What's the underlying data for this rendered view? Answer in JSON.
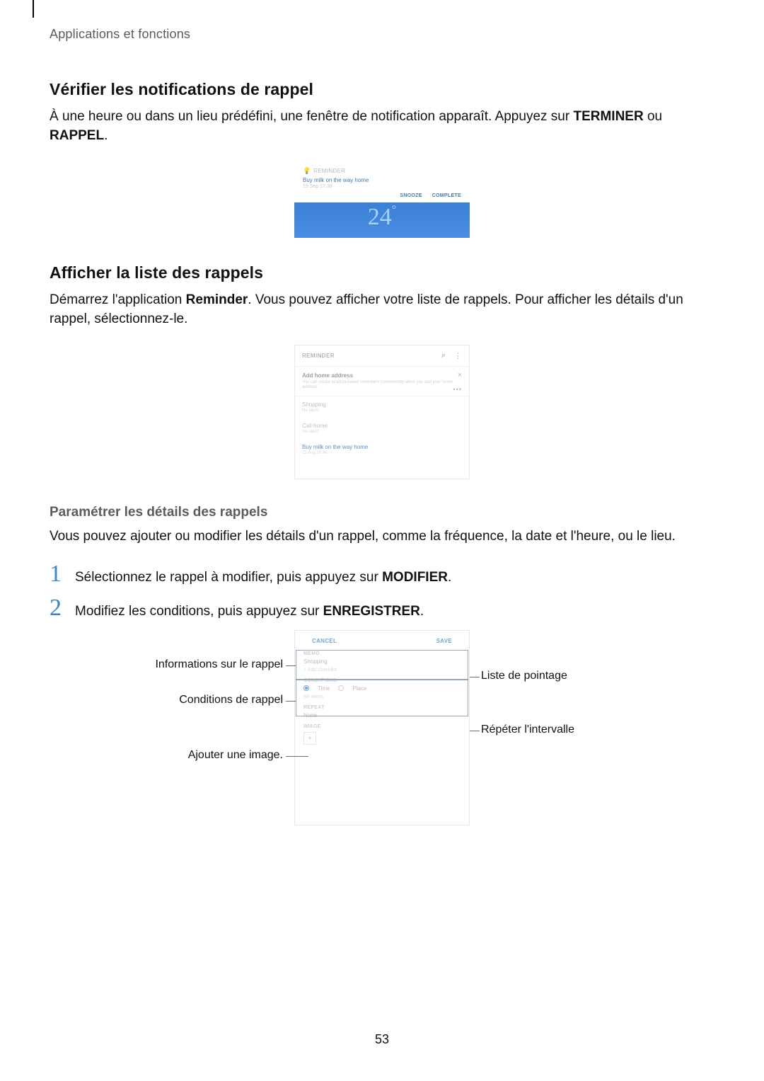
{
  "breadcrumb": "Applications et fonctions",
  "page_number": "53",
  "section1": {
    "heading": "Vérifier les notifications de rappel",
    "body_pre": "À une heure ou dans un lieu prédéfini, une fenêtre de notification apparaît. Appuyez sur ",
    "bold1": "TERMINER",
    "body_mid": " ou ",
    "bold2": "RAPPEL",
    "body_post": "."
  },
  "mock1": {
    "app": "REMINDER",
    "title": "Buy milk on the way home",
    "time": "19 Sep 17:30",
    "action_snooze": "SNOOZE",
    "action_complete": "COMPLETE",
    "temp": "24",
    "deg": "°"
  },
  "section2": {
    "heading": "Afficher la liste des rappels",
    "body_pre": "Démarrez l'application ",
    "bold1": "Reminder",
    "body_post": ". Vous pouvez afficher votre liste de rappels. Pour afficher les détails d'un rappel, sélectionnez-le."
  },
  "mock2": {
    "header": "REMINDER",
    "band_title": "Add home address",
    "band_sub": "You can create location-based reminders conveniently when you add your home address.",
    "items": [
      {
        "title": "Shopping",
        "sub": "No alerts",
        "blue": false
      },
      {
        "title": "Call home",
        "sub": "No alerts",
        "blue": false
      },
      {
        "title": "Buy milk on the way home",
        "sub": "22 Aug 20:00",
        "blue": true
      }
    ]
  },
  "section3": {
    "subheading": "Paramétrer les détails des rappels",
    "body": "Vous pouvez ajouter ou modifier les détails d'un rappel, comme la fréquence, la date et l'heure, ou le lieu.",
    "step1_pre": "Sélectionnez le rappel à modifier, puis appuyez sur ",
    "step1_bold": "MODIFIER",
    "step1_post": ".",
    "step2_pre": "Modifiez les conditions, puis appuyez sur ",
    "step2_bold": "ENREGISTRER",
    "step2_post": "."
  },
  "mock3": {
    "cancel": "CANCEL",
    "save": "SAVE",
    "sect_memo": "MEMO",
    "memo_value": "Shopping",
    "memo_hint": "+  Add checklist",
    "sect_cond": "CONDITIONS",
    "radio_time": "Time",
    "radio_place": "Place",
    "cond_value": "No alerts",
    "sect_repeat": "REPEAT",
    "repeat_value": "None",
    "sect_image": "IMAGE"
  },
  "callouts": {
    "left1": "Informations sur le rappel",
    "left2": "Conditions de rappel",
    "left3": "Ajouter une image.",
    "right1": "Liste de pointage",
    "right2": "Répéter l'intervalle"
  }
}
